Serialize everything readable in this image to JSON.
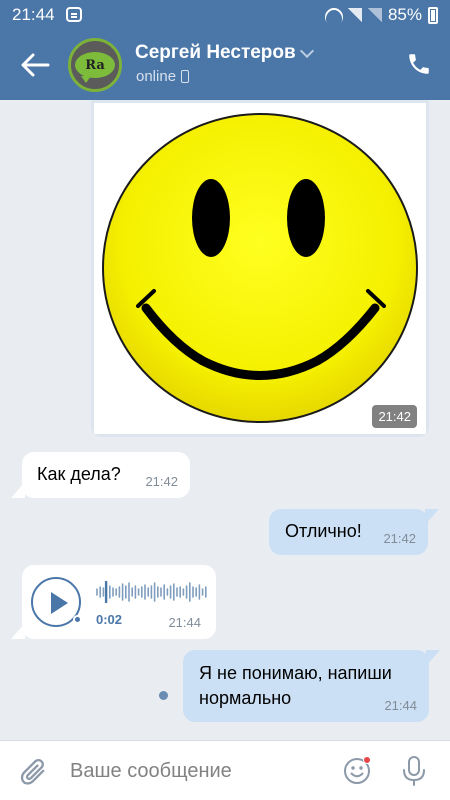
{
  "status_bar": {
    "time": "21:44",
    "battery": "85%"
  },
  "header": {
    "contact_name": "Сергей Нестеров",
    "status": "online",
    "avatar_text": "Ra"
  },
  "messages": [
    {
      "type": "image",
      "direction": "outgoing",
      "time": "21:42",
      "image": "smiley-face"
    },
    {
      "type": "text",
      "direction": "incoming",
      "text": "Как дела?",
      "time": "21:42"
    },
    {
      "type": "text",
      "direction": "outgoing",
      "text": "Отлично!",
      "time": "21:42"
    },
    {
      "type": "voice",
      "direction": "incoming",
      "duration": "0:02",
      "time": "21:44",
      "progress": 0
    },
    {
      "type": "text",
      "direction": "outgoing",
      "text": "Я не понимаю, напиши нормально",
      "time": "21:44"
    }
  ],
  "composer": {
    "placeholder": "Ваше сообщение"
  },
  "colors": {
    "header": "#4a76a8",
    "outgoing_bubble": "#cce0f5",
    "incoming_bubble": "#ffffff",
    "background": "#e9edf1"
  }
}
